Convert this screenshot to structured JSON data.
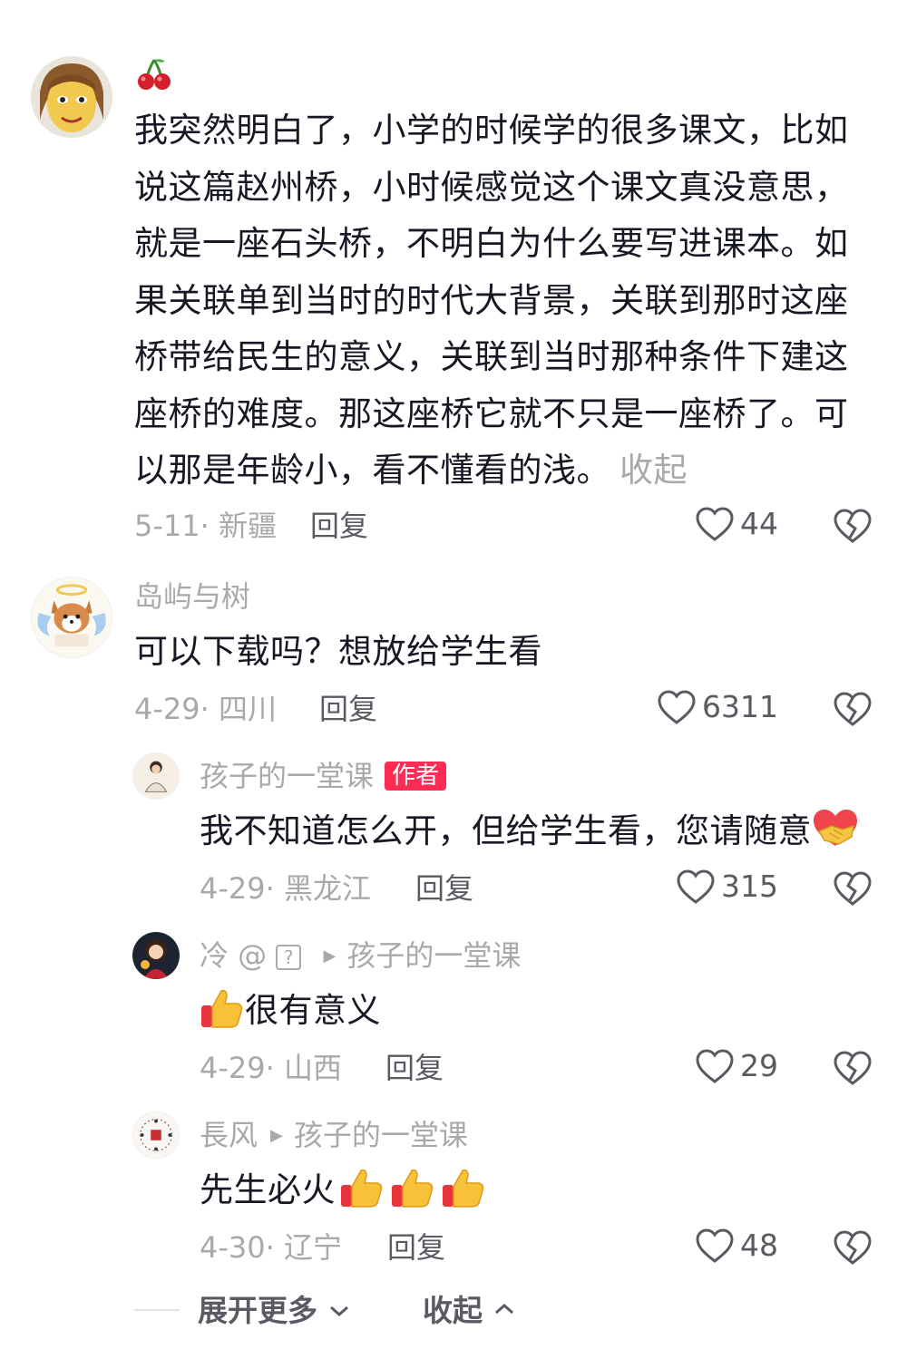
{
  "comments": [
    {
      "username_emoji": "🍒",
      "lines": [
        "我突然明白了，小学的时候学的很多课文，比如",
        "说这篇赵州桥，小时候感觉这个课文真没意思，",
        "就是一座石头桥，不明白为什么要写进课本。如",
        "果关联单到当时的时代大背景，关联到那时这座",
        "桥带给民生的意义，关联到当时那种条件下建这",
        "座桥的难度。那这座桥它就不只是一座桥了。可",
        "以那是年龄小，看不懂看的浅。"
      ],
      "collapse_label": "收起",
      "meta": "5-11· 新疆",
      "reply_label": "回复",
      "likes": "44"
    },
    {
      "username": "岛屿与树",
      "text": "可以下载吗？想放给学生看",
      "meta": "4-29· 四川",
      "reply_label": "回复",
      "likes": "6311"
    }
  ],
  "replies": [
    {
      "username": "孩子的一堂课",
      "badge": "作者",
      "text": "我不知道怎么开，但给学生看，您请随意",
      "trailing_emoji": "handshake-heart",
      "meta": "4-29· 黑龙江",
      "reply_label": "回复",
      "likes": "315"
    },
    {
      "username": "冷 @",
      "username_box": "?",
      "reply_to": "孩子的一堂课",
      "leading_emoji": "thumbs-up",
      "text": "很有意义",
      "meta": "4-29· 山西",
      "reply_label": "回复",
      "likes": "29"
    },
    {
      "username": "長风",
      "reply_to": "孩子的一堂课",
      "text": "先生必火",
      "trailing_emoji": "thumbs-up ×3",
      "meta": "4-30· 辽宁",
      "reply_label": "回复",
      "likes": "48"
    }
  ],
  "footer": {
    "expand_more": "展开更多",
    "collapse": "收起"
  },
  "colors": {
    "text": "#161823",
    "secondary": "#a8a9ad",
    "action": "#5a5b62",
    "badge": "#fe2c55"
  }
}
